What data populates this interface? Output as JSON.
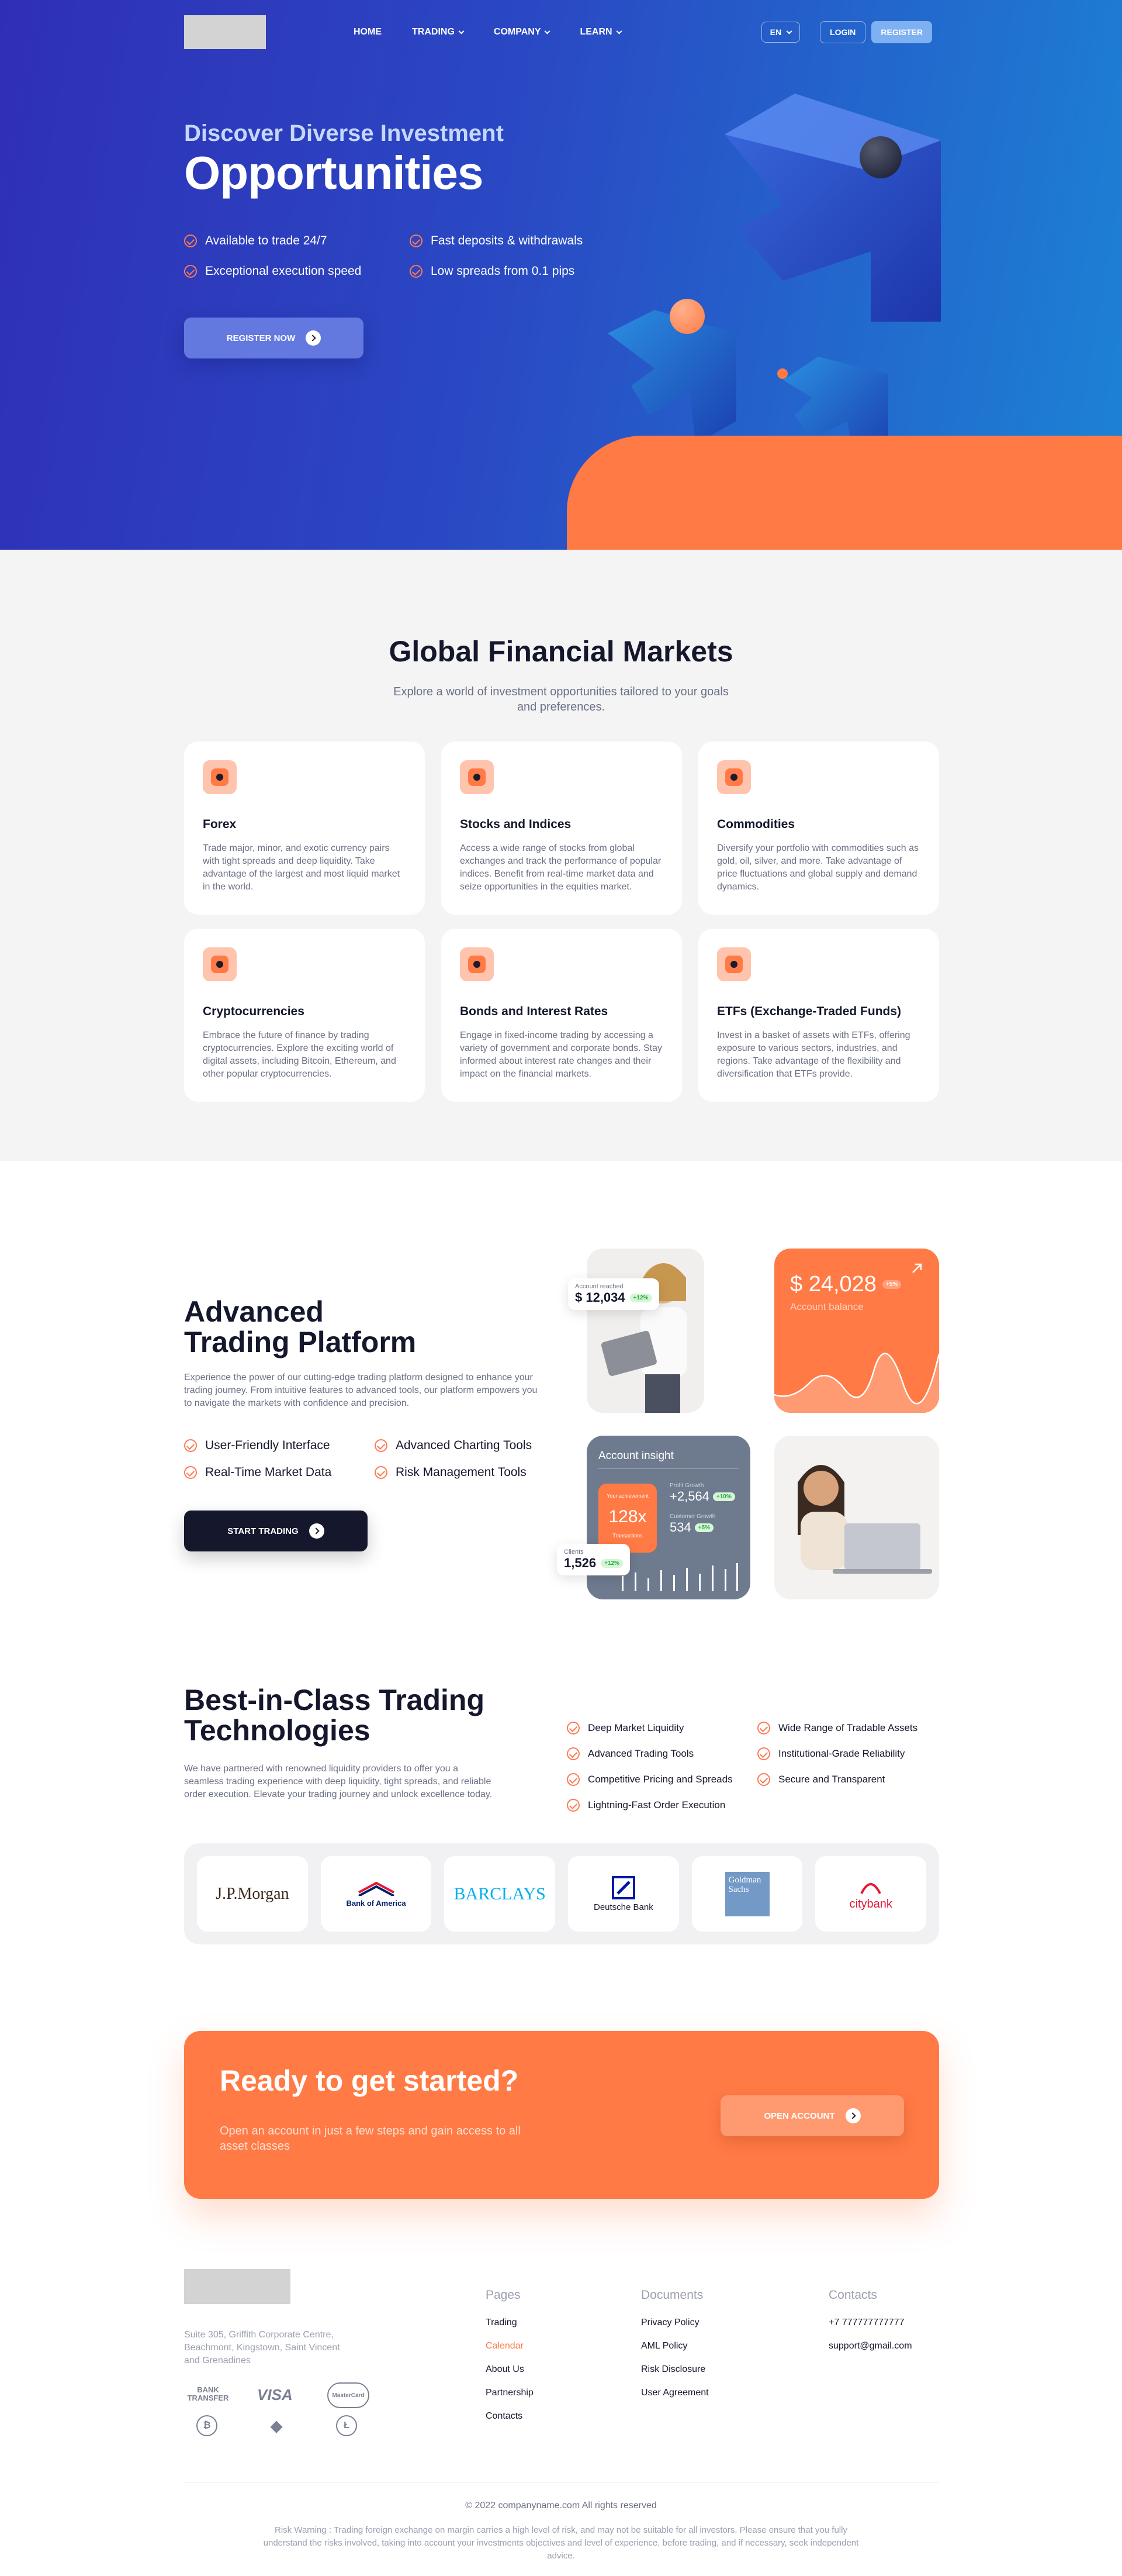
{
  "nav": {
    "items": [
      {
        "label": "HOME"
      },
      {
        "label": "TRADING"
      },
      {
        "label": "COMPANY"
      },
      {
        "label": "LEARN"
      }
    ],
    "lang": "EN",
    "login": "LOGIN",
    "register": "REGISTER"
  },
  "hero": {
    "subtitle": "Discover Diverse Investment",
    "title": "Opportunities",
    "features": [
      "Available to trade 24/7",
      "Fast deposits & withdrawals",
      "Exceptional execution speed",
      "Low spreads from 0.1 pips"
    ],
    "cta": "REGISTER NOW"
  },
  "markets": {
    "title": "Global Financial Markets",
    "description": "Explore a world of investment opportunities tailored to your goals and preferences.",
    "cards": [
      {
        "title": "Forex",
        "text": "Trade major, minor, and exotic currency pairs with tight spreads and deep liquidity. Take advantage of the largest and most liquid market in the world."
      },
      {
        "title": "Stocks and Indices",
        "text": "Access a wide range of stocks from global exchanges and track the performance of popular indices. Benefit from real-time market data and seize opportunities in the equities market."
      },
      {
        "title": "Commodities",
        "text": "Diversify your portfolio with commodities such as gold, oil, silver, and more. Take advantage of price fluctuations and global supply and demand dynamics."
      },
      {
        "title": "Cryptocurrencies",
        "text": "Embrace the future of finance by trading cryptocurrencies. Explore the exciting world of digital assets, including Bitcoin, Ethereum, and other popular cryptocurrencies."
      },
      {
        "title": "Bonds and Interest Rates",
        "text": "Engage in fixed-income trading by accessing a variety of government and corporate bonds. Stay informed about interest rate changes and their impact on the financial markets."
      },
      {
        "title": "ETFs (Exchange-Traded Funds)",
        "text": "Invest in a basket of assets with ETFs, offering exposure to various sectors, industries, and regions. Take advantage of the flexibility and diversification that ETFs provide."
      }
    ]
  },
  "platform": {
    "title_line1": "Advanced",
    "title_line2": "Trading Platform",
    "description": "Experience the power of our cutting-edge trading platform designed to enhance your trading journey. From intuitive features to advanced tools, our platform empowers you to navigate the markets with confidence and precision.",
    "features": [
      "User-Friendly Interface",
      "Advanced Charting Tools",
      "Real-Time Market Data",
      "Risk Management Tools"
    ],
    "cta": "START TRADING",
    "account_reached_label": "Account reached",
    "account_reached_value": "$ 12,034",
    "account_reached_pill": "+12%",
    "balance_value": "$ 24,028",
    "balance_pill": "+5%",
    "balance_label": "Account balance",
    "insight_title": "Account insight",
    "insight_multiplier_label": "Your achievement",
    "insight_multiplier": "128x",
    "insight_multiplier_sub": "Transactions",
    "profit_label": "Profit Growth",
    "profit_value": "+2,564",
    "profit_pill": "+10%",
    "customer_label": "Customer Growth",
    "customer_value": "534",
    "customer_pill": "+5%",
    "clients_label": "Clients",
    "clients_value": "1,526",
    "clients_pill": "+12%"
  },
  "tech": {
    "title_line1": "Best-in-Class Trading",
    "title_line2": "Technologies",
    "description": "We have partnered with renowned liquidity providers to offer you a seamless trading experience with deep liquidity, tight spreads, and reliable order execution. Elevate your trading journey and unlock excellence today.",
    "items": [
      "Deep Market Liquidity",
      "Wide Range of Tradable Assets",
      "Advanced Trading Tools",
      "Institutional-Grade Reliability",
      "Competitive Pricing and Spreads",
      "Secure and Transparent",
      "Lightning-Fast Order Execution"
    ],
    "banks": [
      "J.P.Morgan",
      "Bank of America",
      "BARCLAYS",
      "Deutsche Bank",
      "Goldman Sachs",
      "citybank"
    ]
  },
  "cta": {
    "title": "Ready to get started?",
    "description": "Open an account in just a few steps and gain access to all asset classes",
    "button": "OPEN ACCOUNT"
  },
  "footer": {
    "address": "Suite 305, Griffith Corporate Centre, Beachmont, Kingstown, Saint Vincent and Grenadines",
    "payments": [
      "BANK TRANSFER",
      "VISA",
      "MasterCard"
    ],
    "crypto_icons": [
      "bitcoin-icon",
      "ethereum-icon",
      "litecoin-icon"
    ],
    "pages_head": "Pages",
    "pages": [
      "Trading",
      "Calendar",
      "About Us",
      "Partnership",
      "Contacts"
    ],
    "docs_head": "Documents",
    "docs": [
      "Privacy Policy",
      "AML Policy",
      "Risk Disclosure",
      "User Agreement"
    ],
    "contacts_head": "Contacts",
    "contacts": [
      "+7 777777777777",
      "support@gmail.com"
    ],
    "copyright": "© 2022 companyname.com All rights reserved",
    "risk": "Risk Warning : Trading foreign exchange on margin carries a high level of risk, and may not be suitable for all investors. Please ensure that you fully understand the risks involved, taking into account your investments objectives and level of experience, before trading, and if necessary, seek independent advice."
  },
  "colors": {
    "accent": "#ff7a45",
    "hero_from": "#2f2fb6",
    "hero_to": "#1c83d4",
    "dark": "#15182c"
  }
}
